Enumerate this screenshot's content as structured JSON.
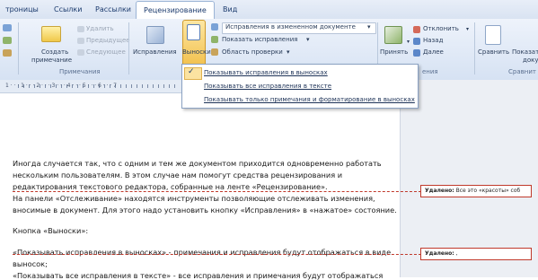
{
  "tabs": [
    "троницы",
    "Ссылки",
    "Рассылки",
    "Рецензирование",
    "Вид"
  ],
  "ribbon": {
    "create_note": [
      "Создать",
      "примечание"
    ],
    "delete": "Удалить",
    "previous": "Предыдущее",
    "next": "Следующее",
    "notes_group": "Примечания",
    "corrections": "Исправления",
    "balloons": "Выноски",
    "display_mode": "Исправления в измененном документе",
    "show_corrections": "Показать исправления",
    "review_pane": "Область проверки",
    "accept": "Принять",
    "reject": "Отклонить",
    "back": "Назад",
    "forward": "Далее",
    "changes_group": "ения",
    "compare": "Сравнить",
    "show_source": [
      "Показат",
      "доку"
    ],
    "compare_group": "Сравнит"
  },
  "ruler": "1 · · · 1 · · · 2 · · · 3 · · · 4 · · · 5 · · · 6 · · · 7",
  "dropdown": {
    "items": [
      "Показывать исправления в выносках",
      "Показывать все исправления в тексте",
      "Показывать только примечания и форматирование в выносках"
    ],
    "checked": 0
  },
  "document": {
    "lines": [
      "Иногда случается так, что с одним и тем же документом приходится одновременно работать",
      "нескольким пользователям. В этом случае нам помогут средства рецензирования и",
      "редактирования текстового редактора, собранные на ленте «Рецензирование».",
      " На панели «Отслеживание» находятся инструменты позволяющие отслеживать изменения,",
      "вносимые в документ.  Для этого надо установить кнопку «Исправления» в «нажатое» состояние.",
      "Кнопка «Выноски»:",
      "«Показывать исправления в выносках» - примечания и исправления будут отображаться в виде",
      "выносок;",
      "«Показывать все исправления в тексте» - все исправления и примечания будут отображаться"
    ]
  },
  "balloons": [
    {
      "label": "Удалено:",
      "text": "Все это «красоты» соб"
    },
    {
      "label": "Удалено:",
      "text": ","
    }
  ],
  "colors": {
    "accent": "#1b3a6d",
    "deletion": "#c0392b",
    "highlight": "#f6d255"
  }
}
